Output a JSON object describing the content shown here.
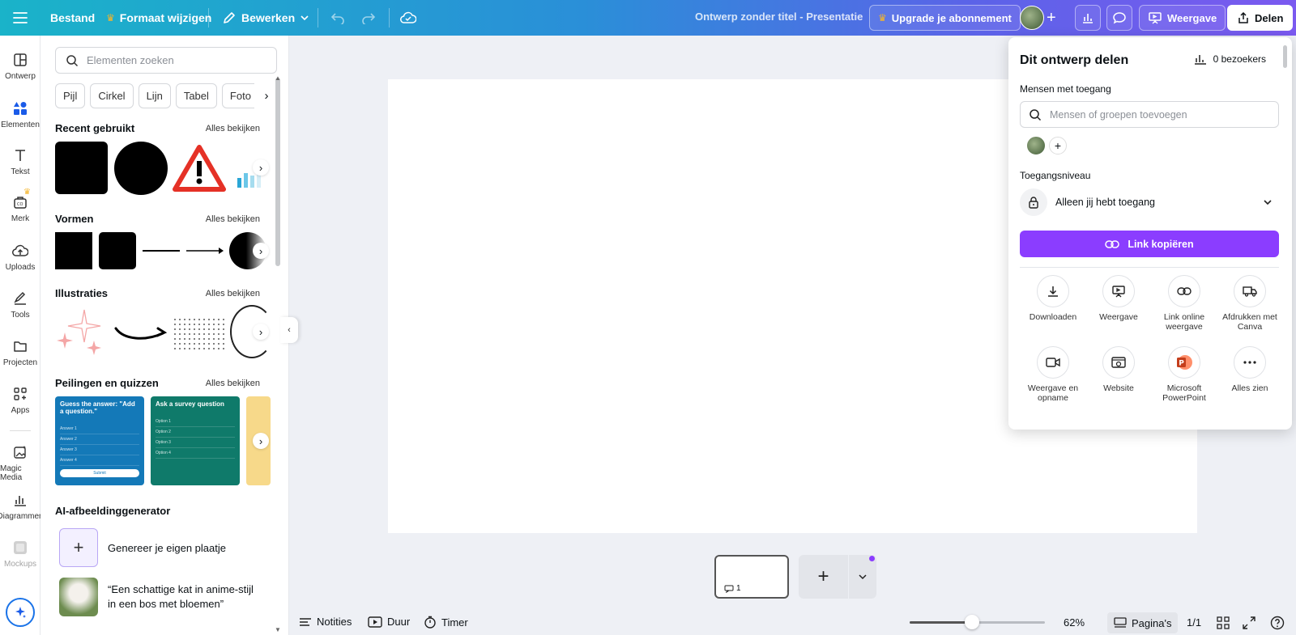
{
  "topbar": {
    "file": "Bestand",
    "resize": "Formaat wijzigen",
    "edit": "Bewerken",
    "doc_title": "Ontwerp zonder titel - Presentatie",
    "upgrade": "Upgrade je abonnement",
    "present": "Weergave",
    "share": "Delen"
  },
  "rail": {
    "items": [
      {
        "label": "Ontwerp",
        "icon": "layout-icon"
      },
      {
        "label": "Elementen",
        "icon": "shapes-icon"
      },
      {
        "label": "Tekst",
        "icon": "text-icon"
      },
      {
        "label": "Merk",
        "icon": "brand-icon"
      },
      {
        "label": "Uploads",
        "icon": "cloud-upload-icon"
      },
      {
        "label": "Tools",
        "icon": "pen-tool-icon"
      },
      {
        "label": "Projecten",
        "icon": "folder-icon"
      },
      {
        "label": "Apps",
        "icon": "apps-grid-icon"
      },
      {
        "label": "Magic Media",
        "icon": "magic-media-icon"
      },
      {
        "label": "Diagrammen",
        "icon": "chart-icon"
      },
      {
        "label": "Mockups",
        "icon": "mockups-icon"
      }
    ]
  },
  "panel": {
    "search_placeholder": "Elementen zoeken",
    "chips": [
      "Pijl",
      "Cirkel",
      "Lijn",
      "Tabel",
      "Foto"
    ],
    "see_all": "Alles bekijken",
    "sections": {
      "recent": "Recent gebruikt",
      "shapes": "Vormen",
      "illustrations": "Illustraties",
      "polls": "Peilingen en quizzen",
      "ai": "AI-afbeeldinggenerator"
    },
    "quizzes": [
      {
        "title": "Guess the answer: \"Add a question.\"",
        "options": [
          "Answer 1",
          "Answer 2",
          "Answer 3",
          "Answer 4"
        ],
        "button": "Submit",
        "color": "#1479b8"
      },
      {
        "title": "Ask a survey question",
        "options": [
          "Option 1",
          "Option 2",
          "Option 3",
          "Option 4"
        ],
        "color": "#0f7a6a"
      }
    ],
    "ai_items": [
      "Genereer je eigen plaatje",
      "“Een schattige kat in anime-stijl in een bos met bloemen”"
    ]
  },
  "footer": {
    "notes": "Notities",
    "duration": "Duur",
    "timer": "Timer",
    "zoom": "62%",
    "zoom_level": 0.46,
    "pages": "Pagina's",
    "page_count": "1/1",
    "page_thumb_num": "1"
  },
  "share": {
    "title": "Dit ontwerp delen",
    "visitors": "0 bezoekers",
    "people_label": "Mensen met toegang",
    "people_placeholder": "Mensen of groepen toevoegen",
    "access_label": "Toegangsniveau",
    "access_value": "Alleen jij hebt toegang",
    "copy_link": "Link kopiëren",
    "options": [
      {
        "label": "Downloaden",
        "icon": "download-icon"
      },
      {
        "label": "Weergave",
        "icon": "present-icon"
      },
      {
        "label": "Link online weergave",
        "icon": "link-icon"
      },
      {
        "label": "Afdrukken met Canva",
        "icon": "truck-icon"
      },
      {
        "label": "Weergave en opname",
        "icon": "video-record-icon"
      },
      {
        "label": "Website",
        "icon": "website-icon"
      },
      {
        "label": "Microsoft PowerPoint",
        "icon": "powerpoint-icon"
      },
      {
        "label": "Alles zien",
        "icon": "more-icon"
      }
    ]
  },
  "colors": {
    "accent": "#8b3dff",
    "topbar_start": "#1ab3c9",
    "topbar_end": "#7b5af0"
  }
}
